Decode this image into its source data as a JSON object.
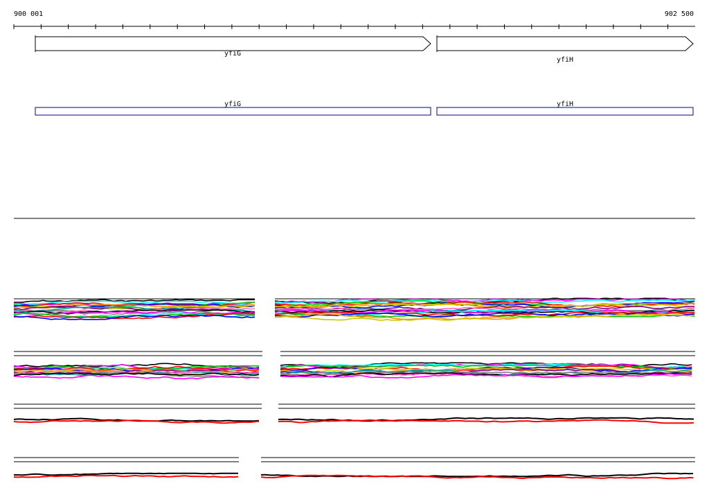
{
  "ruler": {
    "start_label": "900 001",
    "end_label": "902 500"
  },
  "genes": [
    {
      "name": "yfiG",
      "strand": "+"
    },
    {
      "name": "yfiH",
      "strand": "+"
    }
  ],
  "colors": {
    "ruler": "#000000",
    "gene_arrow_stroke": "#000000",
    "gene_box_stroke": "#00008b",
    "separator": "#000000",
    "trace_black": "#000000",
    "trace_red": "#ff0000",
    "trace_palette": [
      "#000000",
      "#ff00ff",
      "#00ffff",
      "#00c800",
      "#ff0000",
      "#0000ff",
      "#ff8c00",
      "#c8c800",
      "#800080",
      "#00a0a0",
      "#ff69b4",
      "#808080"
    ]
  }
}
